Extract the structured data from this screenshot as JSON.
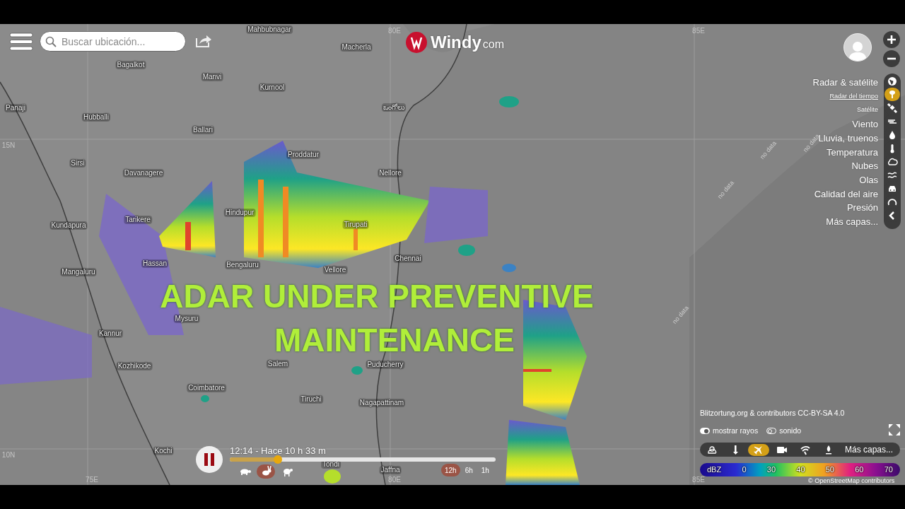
{
  "header": {
    "search": {
      "placeholder": "Buscar ubicación..."
    },
    "logo": {
      "name": "Windy",
      "suffix": "com"
    }
  },
  "map": {
    "grid_labels": [
      "80E",
      "85E",
      "15N",
      "10N",
      "75E",
      "80E",
      "85E"
    ],
    "places": [
      "Mahbubnagar",
      "Macherla",
      "Bagalkot",
      "Manvi",
      "Kurnool",
      "Panaji",
      "Hubballi",
      "Ballari",
      "ఒంగోలు",
      "Sirsi",
      "Davanagere",
      "Proddatur",
      "Nellore",
      "Hindupur",
      "Tarikere",
      "Kundapura",
      "Tirupati",
      "Hassan",
      "Bengaluru",
      "Vellore",
      "Chennai",
      "Mangaluru",
      "Mysuru",
      "Kannur",
      "Kozhikode",
      "Salem",
      "Puducherry",
      "Coimbatore",
      "Tiruchi",
      "Nagapattinam",
      "Kochi",
      "Tondi",
      "Jaffna"
    ],
    "no_data_labels": [
      "no data",
      "no data",
      "no data",
      "no data"
    ],
    "overlay_message": [
      "ADAR UNDER PREVENTIVE",
      "MAINTENANCE"
    ]
  },
  "layers": [
    {
      "label": "Radar & satélite",
      "kind": "heading",
      "selected": false
    },
    {
      "label": "Radar del tiempo",
      "kind": "sub",
      "selected": true
    },
    {
      "label": "Satélite",
      "kind": "sub",
      "selected": false
    },
    {
      "label": "Viento",
      "kind": "layer",
      "selected": false
    },
    {
      "label": "Lluvia, truenos",
      "kind": "layer",
      "selected": false
    },
    {
      "label": "Temperatura",
      "kind": "layer",
      "selected": false
    },
    {
      "label": "Nubes",
      "kind": "layer",
      "selected": false
    },
    {
      "label": "Olas",
      "kind": "layer",
      "selected": false
    },
    {
      "label": "Calidad del aire",
      "kind": "layer",
      "selected": false
    },
    {
      "label": "Presión",
      "kind": "layer",
      "selected": false
    },
    {
      "label": "Más capas...",
      "kind": "layer",
      "selected": false
    }
  ],
  "attribution": "Blitzortung.org & contributors CC-BY-SA 4.0",
  "toggles": [
    {
      "label": "mostrar rayos",
      "on": true
    },
    {
      "label": "sonido",
      "on": false
    }
  ],
  "overlay_bar": {
    "items": [
      {
        "selected": false
      },
      {
        "selected": false
      },
      {
        "selected": true
      },
      {
        "selected": false
      },
      {
        "selected": false
      },
      {
        "selected": false
      }
    ],
    "more": "Más capas..."
  },
  "legend": {
    "unit": "dBZ",
    "labels": [
      "0",
      "30",
      "40",
      "50",
      "60",
      "70"
    ]
  },
  "timeline": {
    "playing": true,
    "time": "12:14 - Hace 10 h 33 m",
    "level": 0.18,
    "speeds": [
      {
        "selected": false
      },
      {
        "selected": true
      },
      {
        "selected": false
      }
    ],
    "ranges": [
      {
        "label": "12h",
        "selected": true
      },
      {
        "label": "6h",
        "selected": false
      },
      {
        "label": "1h",
        "selected": false
      }
    ]
  },
  "copyright": "© OpenStreetMap contributors"
}
